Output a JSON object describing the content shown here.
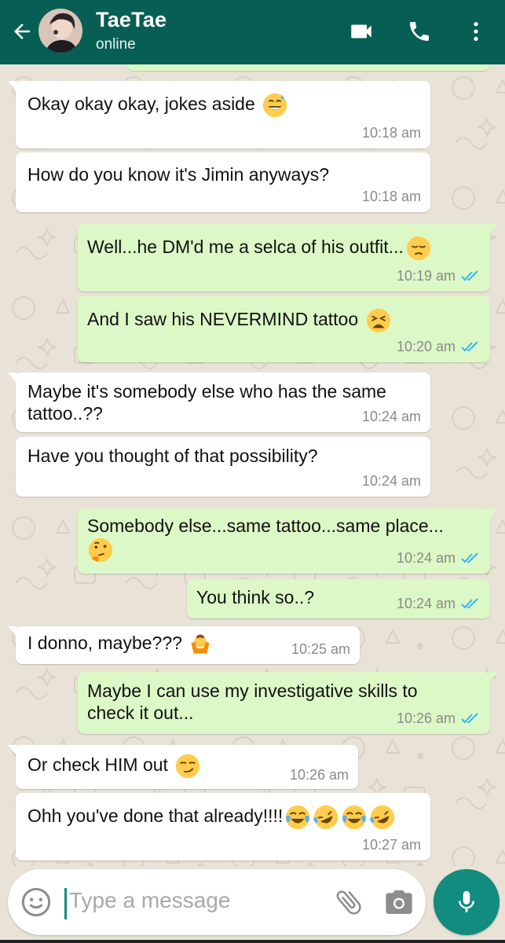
{
  "header": {
    "contact_name": "TaeTae",
    "status": "online",
    "icons": [
      "back-arrow-icon",
      "video-call-icon",
      "voice-call-icon",
      "more-options-icon"
    ]
  },
  "colors": {
    "header": "#075e54",
    "outgoing_bubble": "#dcf8c6",
    "incoming_bubble": "#ffffff",
    "chat_background": "#e9e2d7",
    "read_ticks": "#34b7f1",
    "accent": "#128c7e"
  },
  "messages": [
    {
      "direction": "in",
      "text": "Okay okay okay, jokes aside",
      "emojis": [
        "sweat-smile"
      ],
      "time": "10:18 am"
    },
    {
      "direction": "in",
      "text": "How do you know it's Jimin anyways?",
      "emojis": [],
      "time": "10:18 am"
    },
    {
      "direction": "out",
      "text": "Well...he DM'd me a selca of his outfit...",
      "emojis": [
        "pensive"
      ],
      "time": "10:19 am",
      "read": true
    },
    {
      "direction": "out",
      "text": "And I saw his NEVERMIND tattoo",
      "emojis": [
        "weary"
      ],
      "time": "10:20 am",
      "read": true
    },
    {
      "direction": "in",
      "text": "Maybe it's somebody else who has the same tattoo..??",
      "emojis": [],
      "time": "10:24 am"
    },
    {
      "direction": "in",
      "text": "Have you thought of that possibility?",
      "emojis": [],
      "time": "10:24 am"
    },
    {
      "direction": "out",
      "text": "Somebody else...same tattoo...same place...",
      "emojis": [
        "thinking"
      ],
      "time": "10:24 am",
      "read": true
    },
    {
      "direction": "out",
      "text": "You think so..?",
      "emojis": [],
      "time": "10:24 am",
      "read": true
    },
    {
      "direction": "in",
      "text": "I donno, maybe???",
      "emojis": [
        "shrug"
      ],
      "time": "10:25 am"
    },
    {
      "direction": "out",
      "text": "Maybe I can use my investigative skills to check it out...",
      "emojis": [],
      "time": "10:26 am",
      "read": true
    },
    {
      "direction": "in",
      "text": "Or check HIM out",
      "emojis": [
        "smirk"
      ],
      "time": "10:26 am"
    },
    {
      "direction": "in",
      "text": "Ohh you've done that already!!!!",
      "emojis": [
        "joy",
        "rofl",
        "joy",
        "rofl"
      ],
      "time": "10:27 am"
    }
  ],
  "composer": {
    "placeholder": "Type a message",
    "icons": [
      "emoji-icon",
      "attach-icon",
      "camera-icon",
      "mic-icon"
    ]
  }
}
